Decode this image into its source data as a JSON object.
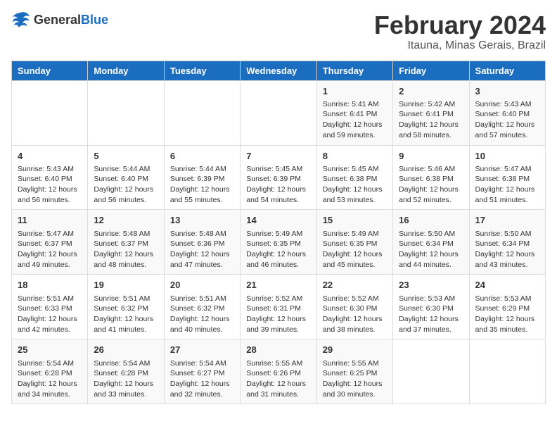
{
  "logo": {
    "general": "General",
    "blue": "Blue"
  },
  "title": "February 2024",
  "subtitle": "Itauna, Minas Gerais, Brazil",
  "days_of_week": [
    "Sunday",
    "Monday",
    "Tuesday",
    "Wednesday",
    "Thursday",
    "Friday",
    "Saturday"
  ],
  "weeks": [
    [
      {
        "day": "",
        "info": ""
      },
      {
        "day": "",
        "info": ""
      },
      {
        "day": "",
        "info": ""
      },
      {
        "day": "",
        "info": ""
      },
      {
        "day": "1",
        "info": "Sunrise: 5:41 AM\nSunset: 6:41 PM\nDaylight: 12 hours\nand 59 minutes."
      },
      {
        "day": "2",
        "info": "Sunrise: 5:42 AM\nSunset: 6:41 PM\nDaylight: 12 hours\nand 58 minutes."
      },
      {
        "day": "3",
        "info": "Sunrise: 5:43 AM\nSunset: 6:40 PM\nDaylight: 12 hours\nand 57 minutes."
      }
    ],
    [
      {
        "day": "4",
        "info": "Sunrise: 5:43 AM\nSunset: 6:40 PM\nDaylight: 12 hours\nand 56 minutes."
      },
      {
        "day": "5",
        "info": "Sunrise: 5:44 AM\nSunset: 6:40 PM\nDaylight: 12 hours\nand 56 minutes."
      },
      {
        "day": "6",
        "info": "Sunrise: 5:44 AM\nSunset: 6:39 PM\nDaylight: 12 hours\nand 55 minutes."
      },
      {
        "day": "7",
        "info": "Sunrise: 5:45 AM\nSunset: 6:39 PM\nDaylight: 12 hours\nand 54 minutes."
      },
      {
        "day": "8",
        "info": "Sunrise: 5:45 AM\nSunset: 6:38 PM\nDaylight: 12 hours\nand 53 minutes."
      },
      {
        "day": "9",
        "info": "Sunrise: 5:46 AM\nSunset: 6:38 PM\nDaylight: 12 hours\nand 52 minutes."
      },
      {
        "day": "10",
        "info": "Sunrise: 5:47 AM\nSunset: 6:38 PM\nDaylight: 12 hours\nand 51 minutes."
      }
    ],
    [
      {
        "day": "11",
        "info": "Sunrise: 5:47 AM\nSunset: 6:37 PM\nDaylight: 12 hours\nand 49 minutes."
      },
      {
        "day": "12",
        "info": "Sunrise: 5:48 AM\nSunset: 6:37 PM\nDaylight: 12 hours\nand 48 minutes."
      },
      {
        "day": "13",
        "info": "Sunrise: 5:48 AM\nSunset: 6:36 PM\nDaylight: 12 hours\nand 47 minutes."
      },
      {
        "day": "14",
        "info": "Sunrise: 5:49 AM\nSunset: 6:35 PM\nDaylight: 12 hours\nand 46 minutes."
      },
      {
        "day": "15",
        "info": "Sunrise: 5:49 AM\nSunset: 6:35 PM\nDaylight: 12 hours\nand 45 minutes."
      },
      {
        "day": "16",
        "info": "Sunrise: 5:50 AM\nSunset: 6:34 PM\nDaylight: 12 hours\nand 44 minutes."
      },
      {
        "day": "17",
        "info": "Sunrise: 5:50 AM\nSunset: 6:34 PM\nDaylight: 12 hours\nand 43 minutes."
      }
    ],
    [
      {
        "day": "18",
        "info": "Sunrise: 5:51 AM\nSunset: 6:33 PM\nDaylight: 12 hours\nand 42 minutes."
      },
      {
        "day": "19",
        "info": "Sunrise: 5:51 AM\nSunset: 6:32 PM\nDaylight: 12 hours\nand 41 minutes."
      },
      {
        "day": "20",
        "info": "Sunrise: 5:51 AM\nSunset: 6:32 PM\nDaylight: 12 hours\nand 40 minutes."
      },
      {
        "day": "21",
        "info": "Sunrise: 5:52 AM\nSunset: 6:31 PM\nDaylight: 12 hours\nand 39 minutes."
      },
      {
        "day": "22",
        "info": "Sunrise: 5:52 AM\nSunset: 6:30 PM\nDaylight: 12 hours\nand 38 minutes."
      },
      {
        "day": "23",
        "info": "Sunrise: 5:53 AM\nSunset: 6:30 PM\nDaylight: 12 hours\nand 37 minutes."
      },
      {
        "day": "24",
        "info": "Sunrise: 5:53 AM\nSunset: 6:29 PM\nDaylight: 12 hours\nand 35 minutes."
      }
    ],
    [
      {
        "day": "25",
        "info": "Sunrise: 5:54 AM\nSunset: 6:28 PM\nDaylight: 12 hours\nand 34 minutes."
      },
      {
        "day": "26",
        "info": "Sunrise: 5:54 AM\nSunset: 6:28 PM\nDaylight: 12 hours\nand 33 minutes."
      },
      {
        "day": "27",
        "info": "Sunrise: 5:54 AM\nSunset: 6:27 PM\nDaylight: 12 hours\nand 32 minutes."
      },
      {
        "day": "28",
        "info": "Sunrise: 5:55 AM\nSunset: 6:26 PM\nDaylight: 12 hours\nand 31 minutes."
      },
      {
        "day": "29",
        "info": "Sunrise: 5:55 AM\nSunset: 6:25 PM\nDaylight: 12 hours\nand 30 minutes."
      },
      {
        "day": "",
        "info": ""
      },
      {
        "day": "",
        "info": ""
      }
    ]
  ]
}
